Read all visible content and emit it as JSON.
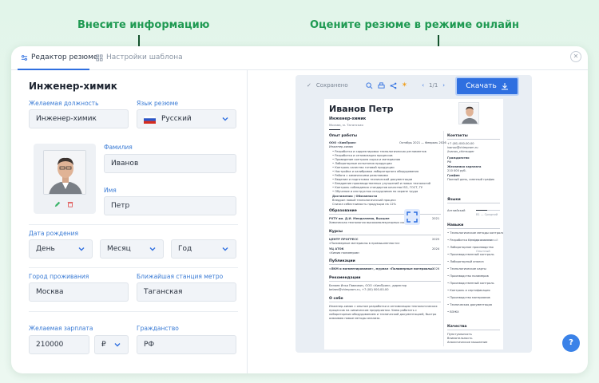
{
  "captions": {
    "left": "Внесите информацию",
    "right": "Оцените резюме в режиме онлайн"
  },
  "tabs": [
    {
      "label": "Редактор резюме",
      "icon": "sliders-icon",
      "active": true
    },
    {
      "label": "Настройки шаблона",
      "icon": "grid-icon",
      "active": false
    }
  ],
  "form": {
    "title": "Инженер-химик",
    "desired_position": {
      "label": "Желаемая должность",
      "value": "Инженер-химик"
    },
    "resume_language": {
      "label": "Язык резюме",
      "value": "Русский"
    },
    "last_name": {
      "label": "Фамилия",
      "value": "Иванов"
    },
    "first_name": {
      "label": "Имя",
      "value": "Петр"
    },
    "birth_date": {
      "label": "Дата рождения",
      "day": "День",
      "month": "Месяц",
      "year": "Год"
    },
    "city": {
      "label": "Город проживания",
      "value": "Москва"
    },
    "metro": {
      "label": "Ближайшая станция метро",
      "value": "Таганская"
    },
    "salary": {
      "label": "Желаемая зарплата",
      "value": "210000",
      "currency": "₽"
    },
    "citizenship": {
      "label": "Гражданство",
      "value": "РФ"
    }
  },
  "preview": {
    "saved": "Сохранено",
    "page": "1/1",
    "download": "Скачать",
    "resume": {
      "name": "Иванов Петр",
      "position": "Инженер-химик",
      "location": "Москва, м. Таганская",
      "experience_title": "Опыт работы",
      "company": "ООО «ХимПром»",
      "company_dates": "Октябрь 2021 — Февраль 2026",
      "job": "Инженер-химик",
      "duties": [
        "Разработка и корректировка технологических регламентов",
        "Разработка и оптимизация процессов",
        "Проведение контроля сырья и материалов",
        "Лабораторные испытания продукции",
        "Контроль качества готовой продукции",
        "Настройка и калибровка лабораторного оборудования",
        "Работа с химическими реактивами",
        "Ведение и подготовка технической документации",
        "Внедрение производственных улучшений и новых технологий",
        "Контроль соблюдения стандартов качества ISO, ГОСТ, ТУ",
        "Обучение и инструктаж сотрудников по охране труда"
      ],
      "achievements_title": "Достижения / Обязанности",
      "achievements": [
        "Внедрил новый технологический процесс",
        "Снизил себестоимость продукции на 12%"
      ],
      "education_title": "Образование",
      "university": "РХТУ им. Д.И. Менделеева, Высшее",
      "university_year": "2021",
      "faculty": "Химическая технология высокомолекулярных соединений",
      "courses_title": "Курсы",
      "courses": [
        {
          "org": "ЦЕНТР ПРОГРЕСС",
          "name": "«Полимерные материалы в промышленности»",
          "year": "2025"
        },
        {
          "org": "УЦ АТОК",
          "name": "«Химия полимеров»",
          "year": "2024"
        }
      ],
      "publications_title": "Публикации",
      "publication": "«ЛКМ и пигментирование», журнал «Полимерные материалы»",
      "publication_year": "2026",
      "recommendations_title": "Рекомендации",
      "recommendation": "Беляев Илья Павлович, ООО «ХимПром», директор",
      "recommendation_contact": "belaev@chimprom.ru, +7 (00) 000-00-00",
      "about_title": "О себе",
      "about": "Инженер-химик с опытом разработки и оптимизации технологических процессов на химическом предприятии. Умею работать с лабораторным оборудованием и технической документацией, быстро осваиваю новые методы анализа.",
      "contacts_title": "Контакты",
      "phone": "+7 (00) 000-00-00",
      "email": "ivanov@chimprom.ru",
      "social": "/ivanov_chimsuper",
      "citizenship_label": "Гражданство",
      "citizenship": "РФ",
      "salary_label": "Желаемая зарплата",
      "salary": "210 000 руб.",
      "schedule_label": "График",
      "schedule": "Полный день, сменный график",
      "languages_title": "Языки",
      "language": "Английский",
      "language_level": "B1 — Средний",
      "skills_title": "Навыки",
      "skills": [
        "Технологические методы контроля",
        "Разработка метода анализа",
        "Лабораторное производство",
        "Производственный контроль",
        "Лабораторный анализ",
        "Технологические карты",
        "Производство полимеров",
        "Производственный контроль",
        "Контроль и сертификация",
        "Производство материалов",
        "Техническая документация",
        "ВЭЖХ"
      ],
      "skill_level_1": "Профессиональный",
      "skill_level_2": "Опытный",
      "qualities_title": "Качества",
      "qualities": [
        "Пунктуальность",
        "Внимательность",
        "Аналитическое мышление"
      ]
    }
  },
  "help": "?",
  "colors": {
    "accent": "#2f6fe0",
    "caption": "#1f9a52",
    "label": "#3a7bd5"
  }
}
